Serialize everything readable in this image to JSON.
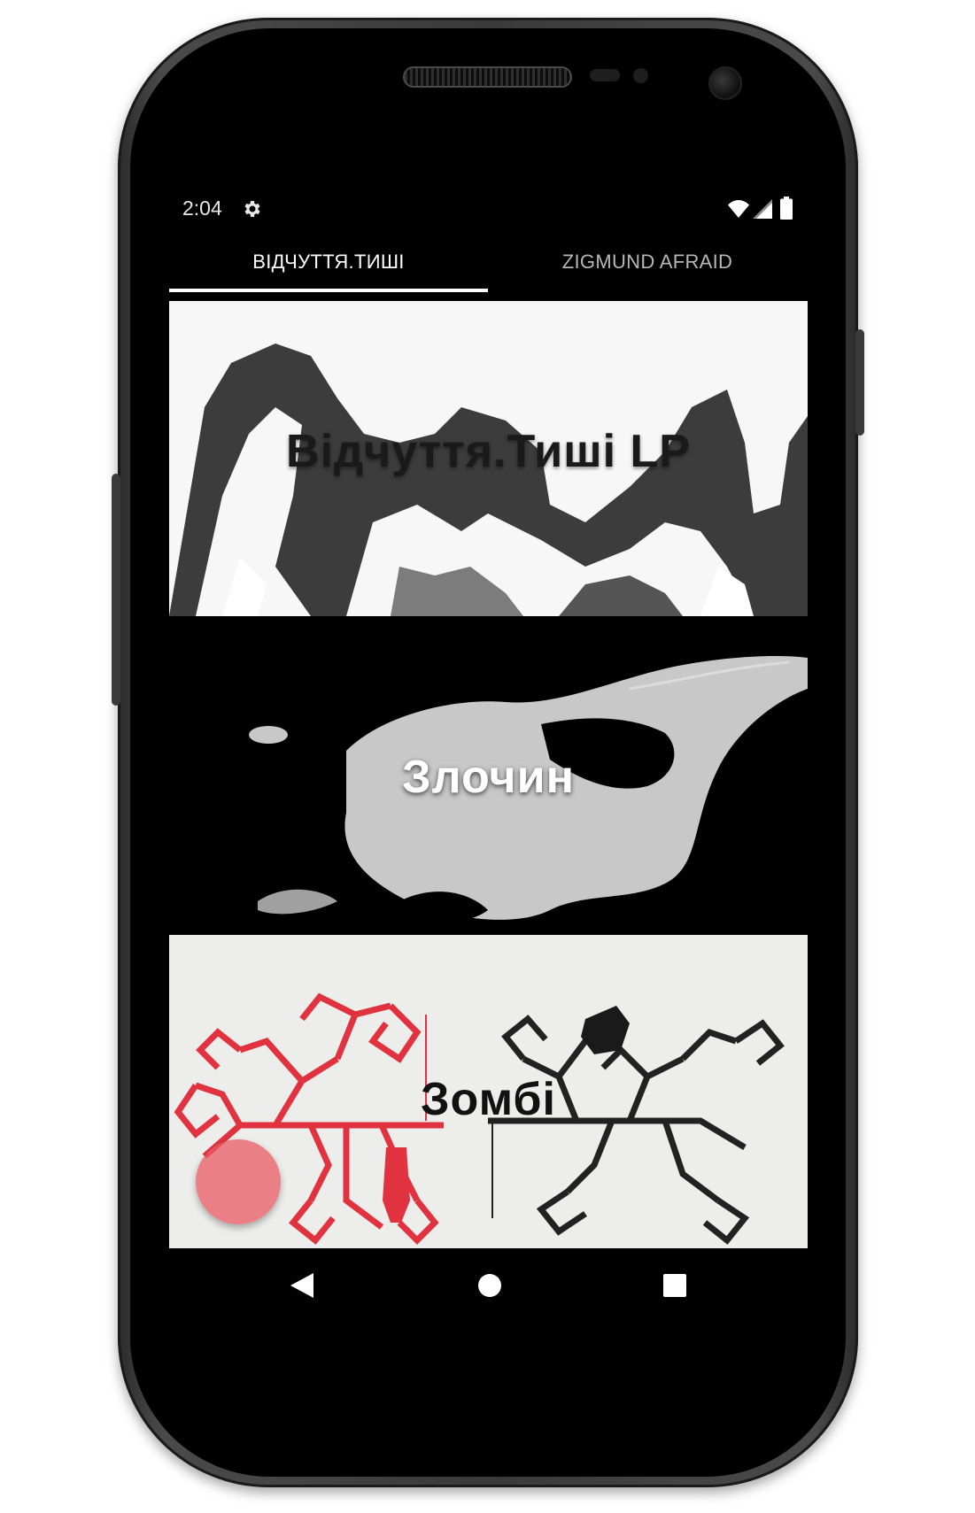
{
  "status_bar": {
    "time": "2:04",
    "icons": [
      "gear-icon",
      "wifi-icon",
      "signal-icon",
      "battery-icon"
    ]
  },
  "tabs": [
    {
      "label": "ВІДЧУТТЯ.ТИШІ",
      "selected": true
    },
    {
      "label": "ZIGMUND AFRAID",
      "selected": false
    }
  ],
  "albums": [
    {
      "title": "Відчуття.Тиші LP"
    },
    {
      "title": "Злочин"
    },
    {
      "title": "Зомбі"
    }
  ],
  "fab": {
    "icon": "fab-button",
    "color": "#e85a64"
  },
  "nav_bar": {
    "icons": [
      "back-icon",
      "home-icon",
      "recents-icon"
    ]
  },
  "colors": {
    "tab_selected": "#ffffff",
    "tab_unselected": "#b7b7b7",
    "screen_bg": "#000000",
    "accent_red": "#e0333f"
  }
}
